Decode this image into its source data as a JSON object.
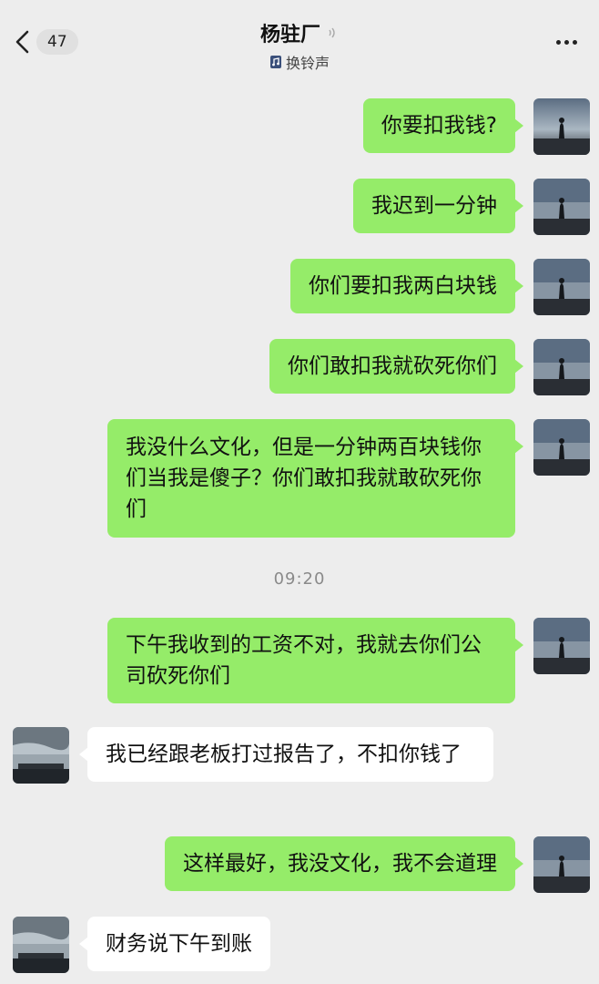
{
  "header": {
    "unread_count": "47",
    "title": "杨驻厂",
    "subtitle": "换铃声"
  },
  "messages": [
    {
      "side": "out",
      "text": "你要扣我钱?"
    },
    {
      "side": "out",
      "text": "我迟到一分钟"
    },
    {
      "side": "out",
      "text": "你们要扣我两白块钱"
    },
    {
      "side": "out",
      "text": "你们敢扣我就砍死你们"
    },
    {
      "side": "out",
      "text": "我没什么文化，但是一分钟两百块钱你们当我是傻子？你们敢扣我就敢砍死你们"
    },
    {
      "side": "out",
      "text": "下午我收到的工资不对，我就去你们公司砍死你们"
    },
    {
      "side": "in",
      "text": "我已经跟老板打过报告了，不扣你钱了"
    },
    {
      "side": "out",
      "text": "这样最好，我没文化，我不会道理"
    },
    {
      "side": "in",
      "text": "财务说下午到账"
    }
  ],
  "timestamp": "09:20",
  "colors": {
    "background": "#ededed",
    "outgoing_bubble": "#95ec69",
    "incoming_bubble": "#ffffff"
  }
}
